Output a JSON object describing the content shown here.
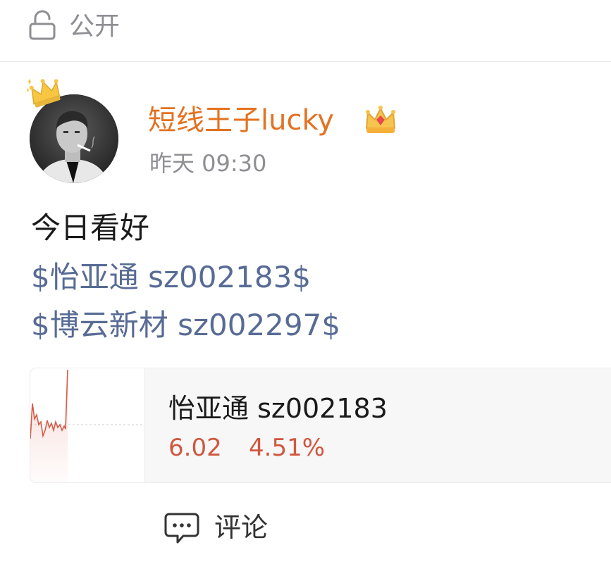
{
  "visibility": {
    "icon": "lock-open-icon",
    "label": "公开"
  },
  "author": {
    "name": "短线王子lucky",
    "badge_icon": "vip-crown-icon",
    "avatar_badge_icon": "crown-icon",
    "time": "昨天 09:30",
    "name_color": "#e37222"
  },
  "post": {
    "text": "今日看好",
    "stock_links": [
      "$怡亚通 sz002183$",
      "$博云新材 sz002297$"
    ],
    "link_color": "#576b95"
  },
  "stock_card": {
    "name": "怡亚通 sz002183",
    "price": "6.02",
    "change": "4.51%",
    "trend_color": "#d0573f"
  },
  "actions": {
    "comment_icon": "comment-icon",
    "comment_label": "评论"
  }
}
